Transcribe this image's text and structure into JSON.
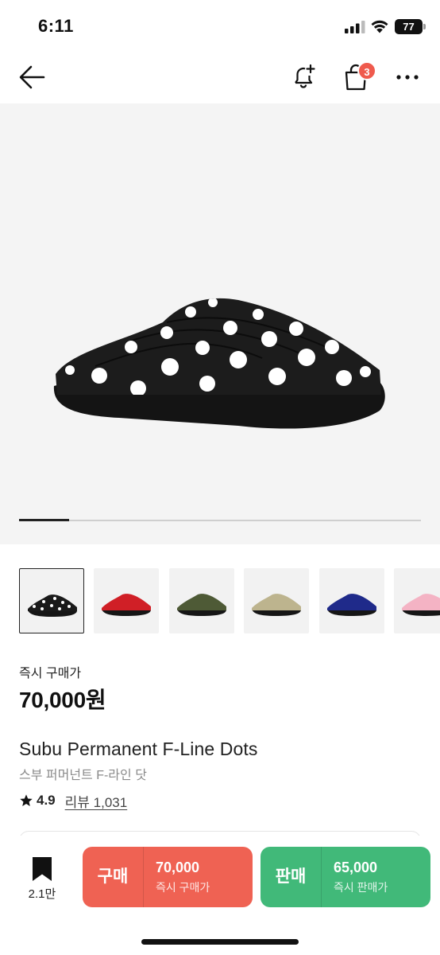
{
  "status_bar": {
    "time": "6:11",
    "battery": "77"
  },
  "nav": {
    "cart_badge": "3"
  },
  "hero": {
    "progress": 0.125
  },
  "thumbnails": [
    {
      "name": "thumb-dots",
      "color": "#1a1a1a"
    },
    {
      "name": "thumb-red",
      "color": "#d01f26"
    },
    {
      "name": "thumb-camo",
      "color": "#4e5a36"
    },
    {
      "name": "thumb-beige",
      "color": "#bdb48e"
    },
    {
      "name": "thumb-navy",
      "color": "#1f2a8a"
    },
    {
      "name": "thumb-pink",
      "color": "#f4b3c4"
    }
  ],
  "price": {
    "label": "즉시 구매가",
    "value": "70,000원"
  },
  "product": {
    "name": "Subu Permanent F-Line Dots",
    "name_ko": "스부 퍼머넌트 F-라인 닷",
    "rating": "4.9",
    "review_label": "리뷰 1,031"
  },
  "bottom_bar": {
    "bookmark_count": "2.1만",
    "buy": {
      "label": "구매",
      "price": "70,000",
      "sub": "즉시 구매가",
      "color": "#ef6253"
    },
    "sell": {
      "label": "판매",
      "price": "65,000",
      "sub": "즉시 판매가",
      "color": "#41b979"
    }
  }
}
